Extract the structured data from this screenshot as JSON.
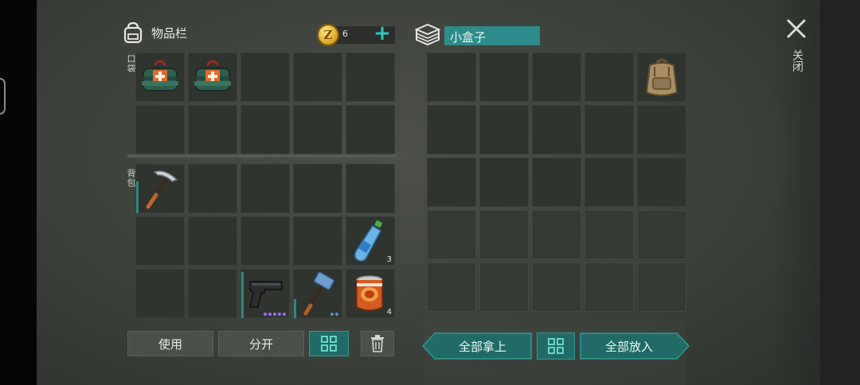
{
  "inventory": {
    "title": "物品栏",
    "coins": "6",
    "pocket_label": "口袋",
    "backpack_label": "背包",
    "pocket_items": [
      {
        "slot": 0,
        "name": "first-aid-kit-icon",
        "qty": ""
      },
      {
        "slot": 1,
        "name": "first-aid-kit-icon",
        "qty": ""
      }
    ],
    "backpack_items": [
      {
        "slot": 0,
        "name": "pickaxe-icon",
        "qty": ""
      },
      {
        "slot": 9,
        "name": "water-bottle-icon",
        "qty": "3"
      },
      {
        "slot": 12,
        "name": "pistol-icon",
        "qty": ""
      },
      {
        "slot": 13,
        "name": "sledgehammer-icon",
        "qty": ""
      },
      {
        "slot": 14,
        "name": "canned-food-icon",
        "qty": "4"
      }
    ],
    "buttons": {
      "use": "使用",
      "split": "分开"
    }
  },
  "container": {
    "title": "小盒子",
    "items": [
      {
        "slot": 4,
        "name": "backpack-icon",
        "qty": ""
      }
    ],
    "buttons": {
      "take_all": "全部拿上",
      "put_all": "全部放入"
    }
  },
  "close_label": "关闭",
  "colors": {
    "accent": "#2cc9c0",
    "teal_button": "#216a68",
    "coin": "#d9a521"
  }
}
